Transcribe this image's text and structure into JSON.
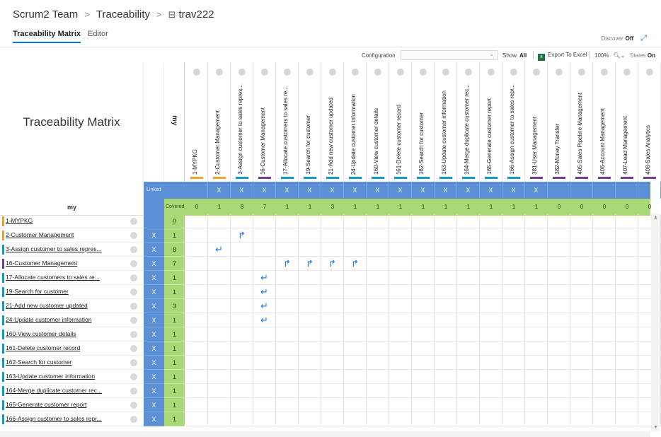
{
  "breadcrumb": {
    "team": "Scrum2 Team",
    "sep1": ">",
    "section": "Traceability",
    "sep2": ">",
    "item": "trav222"
  },
  "tabs": [
    {
      "label": "Traceability Matrix"
    },
    {
      "label": "Editor"
    }
  ],
  "discover": {
    "label": "Discover",
    "value": "Off"
  },
  "toolbar": {
    "configuration_label": "Configuration",
    "configuration_value": "",
    "show_label": "Show",
    "show_value": "All",
    "export_label": "Export To Excel",
    "zoom": "100%",
    "states_label": "States",
    "states_value": "On"
  },
  "matrix": {
    "title": "Traceability Matrix",
    "my_header": "my",
    "my_row_label": "my",
    "linked_label": "Linked",
    "covered_label": "Covered",
    "columns": [
      {
        "label": "1-MYPKG",
        "color": "#f0a030",
        "linked": "",
        "covered": "0"
      },
      {
        "label": "2-Customer Management",
        "color": "#f0a030",
        "linked": "X",
        "covered": "1"
      },
      {
        "label": "3-Assign customer to sales repres...",
        "color": "#00a0c8",
        "linked": "X",
        "covered": "8"
      },
      {
        "label": "16-Customer Management",
        "color": "#773b93",
        "linked": "X",
        "covered": "7"
      },
      {
        "label": "17-Allocate customers to sales re...",
        "color": "#00a0c8",
        "linked": "X",
        "covered": "1"
      },
      {
        "label": "19-Search for customer",
        "color": "#00a0c8",
        "linked": "X",
        "covered": "1"
      },
      {
        "label": "21-Add new customer updated",
        "color": "#00a0c8",
        "linked": "X",
        "covered": "3"
      },
      {
        "label": "24-Update customer information",
        "color": "#00a0c8",
        "linked": "X",
        "covered": "1"
      },
      {
        "label": "160-View customer details",
        "color": "#00a0c8",
        "linked": "X",
        "covered": "1"
      },
      {
        "label": "161-Delete customer record",
        "color": "#00a0c8",
        "linked": "X",
        "covered": "1"
      },
      {
        "label": "162-Search for customer",
        "color": "#00a0c8",
        "linked": "X",
        "covered": "1"
      },
      {
        "label": "163-Update customer information",
        "color": "#00a0c8",
        "linked": "X",
        "covered": "1"
      },
      {
        "label": "164-Merge duplicate customer rec...",
        "color": "#00a0c8",
        "linked": "X",
        "covered": "1"
      },
      {
        "label": "165-Generate customer report",
        "color": "#00a0c8",
        "linked": "X",
        "covered": "1"
      },
      {
        "label": "166-Assign customer to sales repr...",
        "color": "#00a0c8",
        "linked": "X",
        "covered": "1"
      },
      {
        "label": "381-User Management",
        "color": "#773b93",
        "linked": "X",
        "covered": "1"
      },
      {
        "label": "382-Money Transfer",
        "color": "#773b93",
        "linked": "",
        "covered": "0"
      },
      {
        "label": "405-Sales Pipeline Management",
        "color": "#773b93",
        "linked": "",
        "covered": "0"
      },
      {
        "label": "406-Account Management",
        "color": "#773b93",
        "linked": "",
        "covered": "0"
      },
      {
        "label": "407-Lead Management",
        "color": "#773b93",
        "linked": "",
        "covered": "0"
      },
      {
        "label": "408-Sales Analytics",
        "color": "#773b93",
        "linked": "",
        "covered": "0"
      }
    ],
    "rows": [
      {
        "label": "1-MYPKG",
        "color": "#f0a030",
        "x": "",
        "covered": "0",
        "cells": {}
      },
      {
        "label": "2-Customer Management",
        "color": "#f0a030",
        "x": "X",
        "covered": "1",
        "cells": {
          "2": "↱"
        }
      },
      {
        "label": "3-Assign customer to sales repres...",
        "color": "#00a0c8",
        "x": "X",
        "covered": "8",
        "cells": {
          "1": "↵"
        }
      },
      {
        "label": "16-Customer Management",
        "color": "#773b93",
        "x": "X",
        "covered": "7",
        "cells": {
          "4": "↱",
          "5": "↱",
          "6": "↱",
          "7": "↱"
        }
      },
      {
        "label": "17-Allocate customers to sales re...",
        "color": "#00a0c8",
        "x": "X",
        "covered": "1",
        "cells": {
          "3": "↵"
        }
      },
      {
        "label": "19-Search for customer",
        "color": "#00a0c8",
        "x": "X",
        "covered": "1",
        "cells": {
          "3": "↵"
        }
      },
      {
        "label": "21-Add new customer updated",
        "color": "#00a0c8",
        "x": "X",
        "covered": "3",
        "cells": {
          "3": "↵"
        }
      },
      {
        "label": "24-Update customer information",
        "color": "#00a0c8",
        "x": "X",
        "covered": "1",
        "cells": {
          "3": "↵"
        }
      },
      {
        "label": "160-View customer details",
        "color": "#00a0c8",
        "x": "X",
        "covered": "1",
        "cells": {}
      },
      {
        "label": "161-Delete customer record",
        "color": "#00a0c8",
        "x": "X",
        "covered": "1",
        "cells": {}
      },
      {
        "label": "162-Search for customer",
        "color": "#00a0c8",
        "x": "X",
        "covered": "1",
        "cells": {}
      },
      {
        "label": "163-Update customer information",
        "color": "#00a0c8",
        "x": "X",
        "covered": "1",
        "cells": {}
      },
      {
        "label": "164-Merge duplicate customer rec...",
        "color": "#00a0c8",
        "x": "X",
        "covered": "1",
        "cells": {}
      },
      {
        "label": "165-Generate customer report",
        "color": "#00a0c8",
        "x": "X",
        "covered": "1",
        "cells": {}
      },
      {
        "label": "166-Assign customer to sales repr...",
        "color": "#00a0c8",
        "x": "X",
        "covered": "1",
        "cells": {}
      }
    ]
  }
}
